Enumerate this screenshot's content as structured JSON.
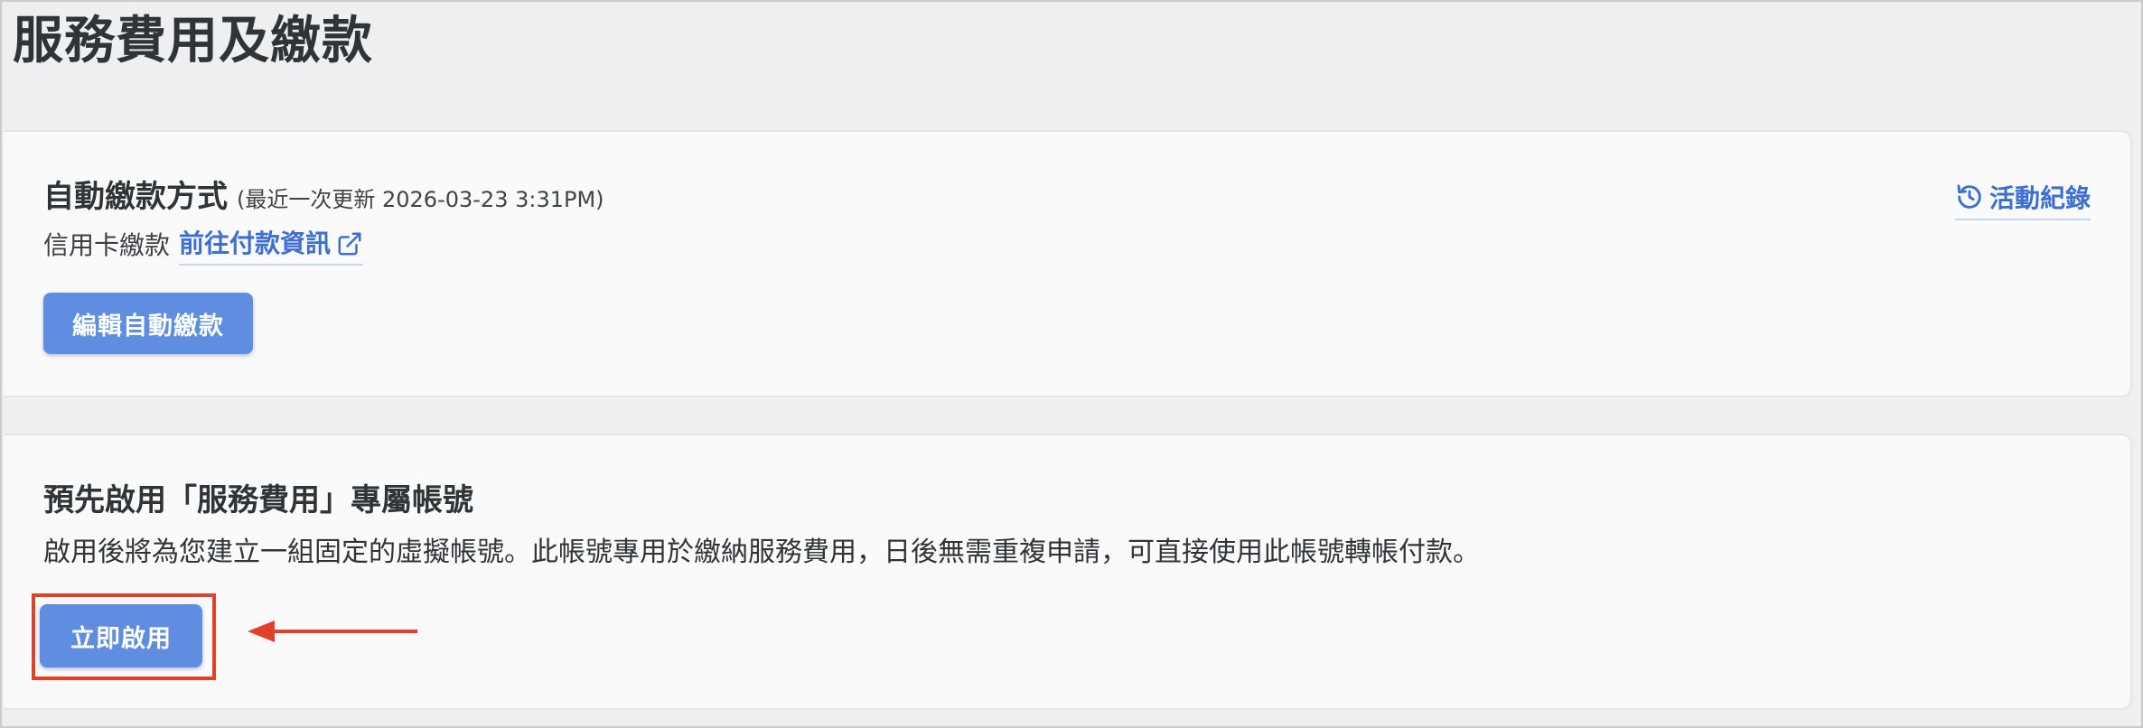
{
  "page": {
    "title": "服務費用及繳款"
  },
  "auto_payment": {
    "title": "自動繳款方式",
    "updated_note": "(最近一次更新 2026-03-23 3:31PM)",
    "method_label": "信用卡繳款",
    "payment_link_label": "前往付款資訊",
    "payment_link_icon": "external-link-icon",
    "activity_link_label": "活動紀錄",
    "activity_link_icon": "history-icon",
    "edit_button_label": "編輯自動繳款"
  },
  "dedicated_account": {
    "title": "預先啟用「服務費用」專屬帳號",
    "description": "啟用後將為您建立一組固定的虛擬帳號。此帳號專用於繳納服務費用，日後無需重複申請，可直接使用此帳號轉帳付款。",
    "enable_button_label": "立即啟用"
  },
  "colors": {
    "accent": "#5f8ee0",
    "link": "#3d6fd1",
    "annotation": "#e2402a"
  }
}
